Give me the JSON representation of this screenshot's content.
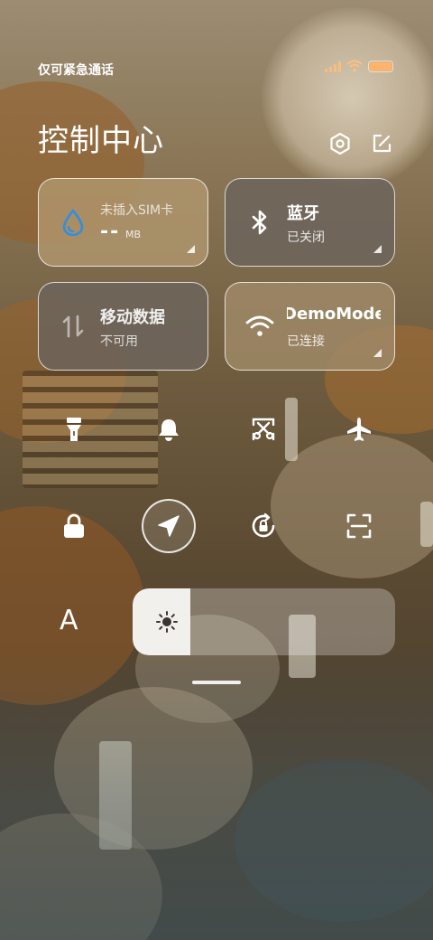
{
  "status_bar": {
    "carrier": "仅可紧急通话",
    "battery_level": 1.0,
    "accent_color": "#ffb36b"
  },
  "header": {
    "title": "控制中心",
    "settings_icon": "hexagon-settings-icon",
    "edit_icon": "edit-icon"
  },
  "tiles": {
    "sim": {
      "title": "未插入SIM卡",
      "value": "--",
      "unit": "MB",
      "icon": "water-drop-icon",
      "icon_color": "#2f8fe0"
    },
    "bluetooth": {
      "title": "蓝牙",
      "status": "已关闭",
      "icon": "bluetooth-icon"
    },
    "mobile_data": {
      "title": "移动数据",
      "status": "不可用",
      "icon": "data-arrows-icon"
    },
    "wifi": {
      "title": "DemoMode",
      "status": "已连接",
      "icon": "wifi-icon"
    }
  },
  "toggles": [
    {
      "name": "flashlight",
      "icon": "flashlight-icon",
      "active": false
    },
    {
      "name": "bell",
      "icon": "bell-icon",
      "active": false
    },
    {
      "name": "screenshot",
      "icon": "scissors-icon",
      "active": false
    },
    {
      "name": "airplane",
      "icon": "airplane-icon",
      "active": false
    },
    {
      "name": "lock",
      "icon": "lock-icon",
      "active": false
    },
    {
      "name": "location",
      "icon": "location-arrow-icon",
      "active": true
    },
    {
      "name": "rotation-lock",
      "icon": "rotation-lock-icon",
      "active": false
    },
    {
      "name": "scanner",
      "icon": "scan-icon",
      "active": false
    }
  ],
  "brightness": {
    "auto_label": "A",
    "level": 0.22,
    "icon": "brightness-sun-icon"
  }
}
